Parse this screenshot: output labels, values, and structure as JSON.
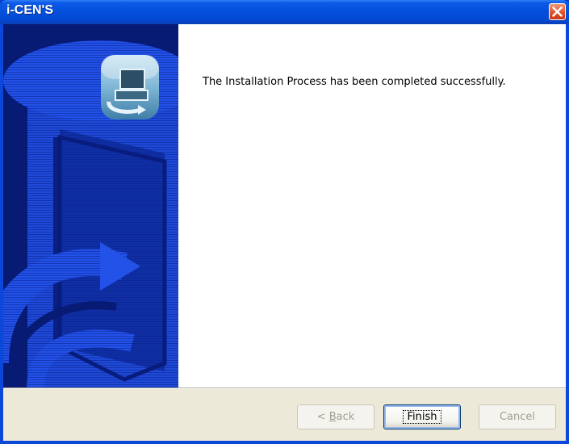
{
  "window": {
    "title": "i-CEN'S"
  },
  "content": {
    "message": "The Installation Process has been completed successfully."
  },
  "buttons": {
    "back_label_prefix": "< ",
    "back_label_mnemonic": "B",
    "back_label_rest": "ack",
    "finish_label": "Finish",
    "cancel_label": "Cancel"
  },
  "icons": {
    "close": "close-icon",
    "installer": "installer-computer-icon"
  },
  "colors": {
    "banner": "#071a74",
    "banner_art": "#1e4ee6",
    "titlebar": "#0451dc",
    "close": "#e0532a"
  }
}
